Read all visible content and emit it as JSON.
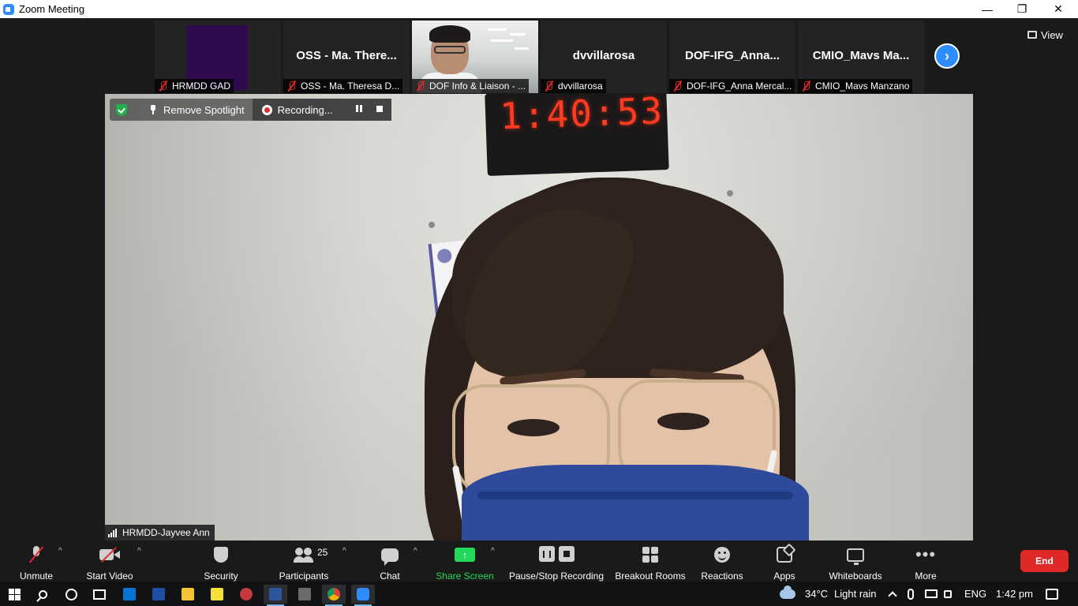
{
  "window": {
    "title": "Zoom Meeting",
    "minimize": "—",
    "restore": "❐",
    "close": "✕"
  },
  "thumbnails": [
    {
      "bigname": "",
      "label": "HRMDD GAD"
    },
    {
      "bigname": "OSS - Ma. There...",
      "label": "OSS - Ma. Theresa D..."
    },
    {
      "bigname": "",
      "label": "DOF Info & Liaison - ..."
    },
    {
      "bigname": "dvvillarosa",
      "label": "dvvillarosa"
    },
    {
      "bigname": "DOF-IFG_Anna...",
      "label": "DOF-IFG_Anna Mercal..."
    },
    {
      "bigname": "CMIO_Mavs Ma...",
      "label": "CMIO_Mavs Manzano"
    }
  ],
  "next_page_glyph": "›",
  "view_label": "View",
  "spotlight": {
    "remove_label": "Remove Spotlight",
    "recording_label": "Recording..."
  },
  "clock_display": "1:40:53",
  "speaker_name": "HRMDD-Jayvee Ann",
  "toolbar": {
    "unmute": "Unmute",
    "start_video": "Start Video",
    "security": "Security",
    "participants": "Participants",
    "participant_count": "25",
    "chat": "Chat",
    "share_screen": "Share Screen",
    "share_glyph": "↑",
    "pause_stop_recording": "Pause/Stop Recording",
    "breakout_rooms": "Breakout Rooms",
    "reactions": "Reactions",
    "apps": "Apps",
    "whiteboards": "Whiteboards",
    "more": "More",
    "more_glyph": "•••",
    "caret": "^",
    "end": "End"
  },
  "taskbar": {
    "weather_temp": "34°C",
    "weather_text": "Light rain",
    "language": "ENG",
    "time": "1:42 pm"
  },
  "colors": {
    "accent_blue": "#2d8cff",
    "share_green": "#23d959",
    "end_red": "#e02828",
    "recording_red": "#e0302c",
    "shield_green": "#22b14c"
  }
}
